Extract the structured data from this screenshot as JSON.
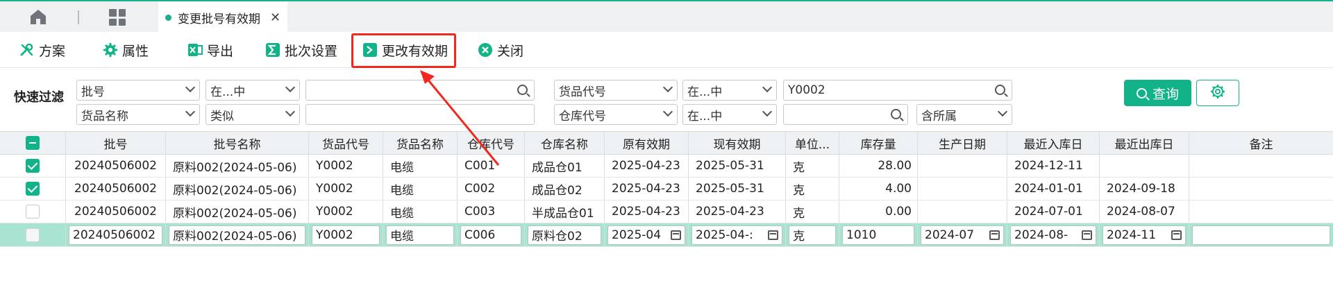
{
  "tabbar": {
    "active_tab": "变更批号有效期",
    "close_glyph": "✕"
  },
  "toolbar": {
    "items": [
      "方案",
      "属性",
      "导出",
      "批次设置",
      "更改有效期",
      "关闭"
    ]
  },
  "filter": {
    "label": "快速过滤",
    "row1": {
      "field1": "批号",
      "op1": "在...中",
      "value1": "",
      "field2": "货品代号",
      "op2": "在...中",
      "value2": "Y0002"
    },
    "row2": {
      "field1": "货品名称",
      "op1": "类似",
      "value1": "",
      "field2": "仓库代号",
      "op2": "在...中",
      "value2": "",
      "scope": "含所属"
    },
    "query_label": "查询"
  },
  "grid": {
    "headers": [
      "批号",
      "批号名称",
      "货品代号",
      "货品名称",
      "仓库代号",
      "仓库名称",
      "原有效期",
      "现有效期",
      "单位...",
      "库存量",
      "生产日期",
      "最近入库日",
      "最近出库日",
      "备注"
    ],
    "rows": [
      {
        "checked": true,
        "cells": [
          "20240506002",
          "原料002(2024-05-06)",
          "Y0002",
          "电缆",
          "C001",
          "成品仓01",
          "2025-04-23",
          "2025-05-31",
          "克",
          "28.00",
          "",
          "2024-12-11",
          "",
          ""
        ]
      },
      {
        "checked": true,
        "cells": [
          "20240506002",
          "原料002(2024-05-06)",
          "Y0002",
          "电缆",
          "C002",
          "成品仓02",
          "2025-04-23",
          "2025-05-31",
          "克",
          "4.00",
          "",
          "2024-01-01",
          "2024-09-18",
          ""
        ]
      },
      {
        "checked": false,
        "cells": [
          "20240506002",
          "原料002(2024-05-06)",
          "Y0002",
          "电缆",
          "C003",
          "半成品仓01",
          "2025-04-23",
          "2025-04-23",
          "克",
          "0.00",
          "",
          "2024-07-01",
          "2024-08-07",
          ""
        ]
      }
    ],
    "edit_row": [
      "20240506002",
      "原料002(2024-05-06)",
      "Y0002",
      "电缆",
      "C006",
      "原料仓02",
      "2025-04",
      "2025-04-:",
      "克",
      "1010",
      "2024-07",
      "2024-08-",
      "2024-11",
      ""
    ]
  },
  "colors": {
    "accent": "#13b389",
    "highlight": "#f2271e",
    "edit_row_bg": "#a8e4d1"
  }
}
